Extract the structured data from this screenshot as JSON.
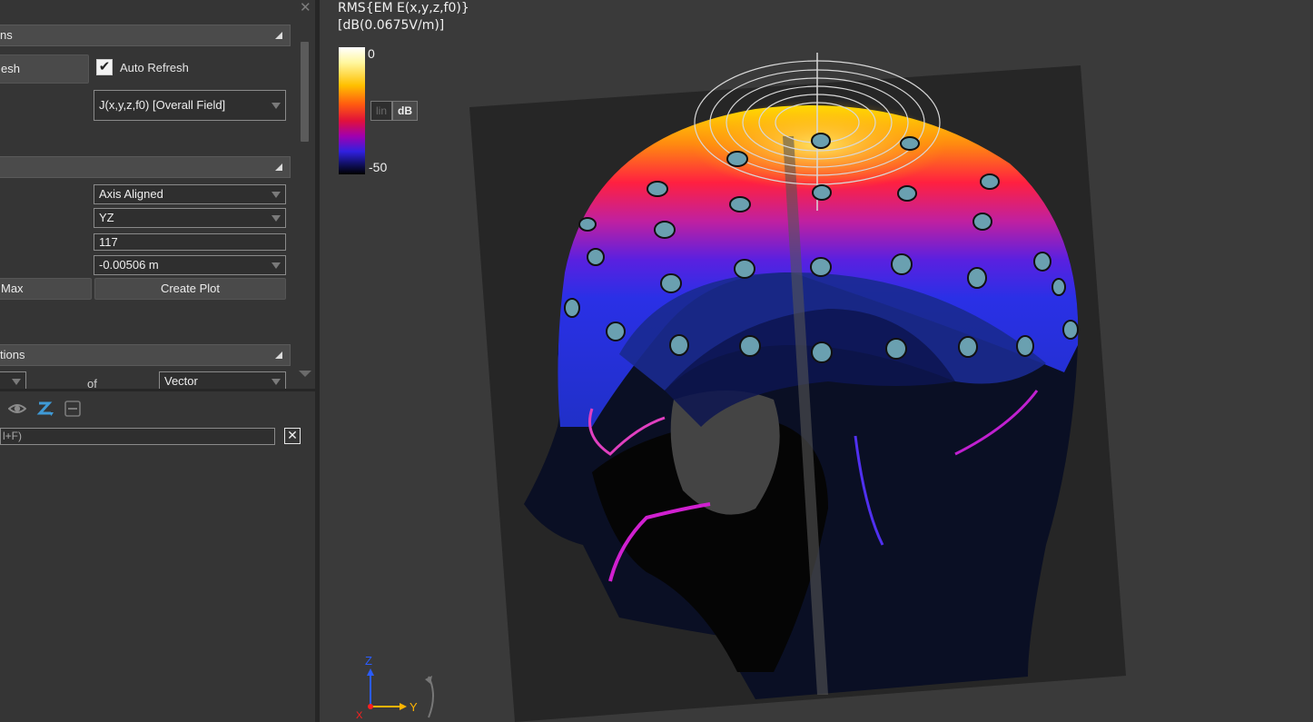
{
  "panel": {
    "section1_header": "ns",
    "refresh_button": "esh",
    "auto_refresh_label": "Auto Refresh",
    "auto_refresh_checked": true,
    "quantity_value": "J(x,y,z,f0) [Overall Field]",
    "section2_header": "",
    "alignment_value": "Axis Aligned",
    "plane_value": "YZ",
    "slice_index_value": "117",
    "slice_position_value": "-0.00506 m",
    "max_button": "Max",
    "create_plot_button": "Create Plot",
    "section3_header": "tions",
    "partial_dropdown_value": "",
    "of_label": "of",
    "vector_value": "Vector",
    "filter_value": "l+F)",
    "clear_filter_symbol": "✕"
  },
  "viewport": {
    "title_line1": "RMS{EM E(x,y,z,f0)}",
    "title_line2": "[dB(0.0675V/m)]",
    "colorbar_max": "0",
    "colorbar_min": "-50",
    "scale_lin": "lin",
    "scale_db": "dB",
    "scale_selected": "dB",
    "axis_z": "Z",
    "axis_y": "Y",
    "axis_x": "X"
  },
  "colors": {
    "panel_bg": "#353535",
    "viewport_bg": "#3a3a3a",
    "field_blue": "#2a2ad0",
    "field_purple": "#7a1ac8",
    "field_red": "#e8203a",
    "field_yellow": "#ffd000",
    "axis_z": "#2a5cff",
    "axis_y": "#ffb400",
    "axis_x": "#ff2020"
  },
  "icons": [
    "eye-icon",
    "z-sort-icon",
    "collapse-icon",
    "close-icon",
    "checkmark-icon",
    "dropdown-arrow-icon",
    "collapse-triangle-icon"
  ]
}
